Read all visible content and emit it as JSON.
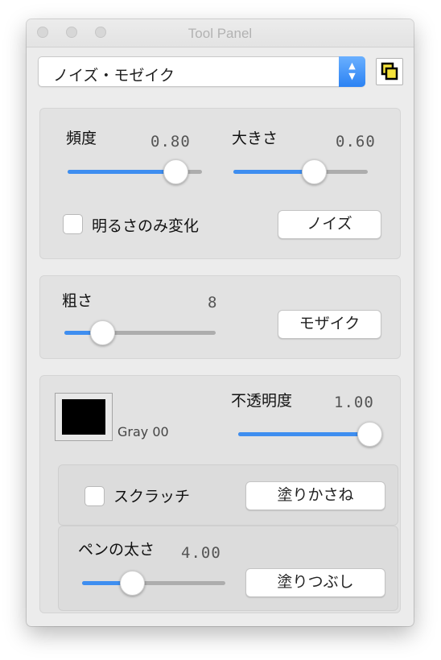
{
  "window": {
    "title": "Tool Panel",
    "traffic_lights": [
      "close",
      "minimize",
      "zoom"
    ]
  },
  "filter_select": {
    "selected": "ノイズ・モゼイク"
  },
  "noise": {
    "frequency_label": "頻度",
    "frequency_value": "0.80",
    "frequency_level": 0.8,
    "size_label": "大きさ",
    "size_value": "0.60",
    "size_level": 0.6,
    "brightness_only_label": "明るさのみ変化",
    "brightness_only_checked": false,
    "button_label": "ノイズ"
  },
  "mosaic": {
    "coarseness_label": "粗さ",
    "coarseness_value": "8",
    "coarseness_level": 0.25,
    "button_label": "モザイク"
  },
  "paint": {
    "color_name": "Gray 00",
    "color": "#000000",
    "opacity_label": "不透明度",
    "opacity_value": "1.00",
    "opacity_level": 1.0,
    "scratch_label": "スクラッチ",
    "scratch_checked": false,
    "overlay_button": "塗りかさね",
    "pen_width_label": "ペンの太さ",
    "pen_width_value": "4.00",
    "pen_width_level": 0.35,
    "fill_button": "塗りつぶし"
  },
  "colors": {
    "accent": "#3e8ef0",
    "track": "#adadad",
    "panel": "#ececec"
  }
}
